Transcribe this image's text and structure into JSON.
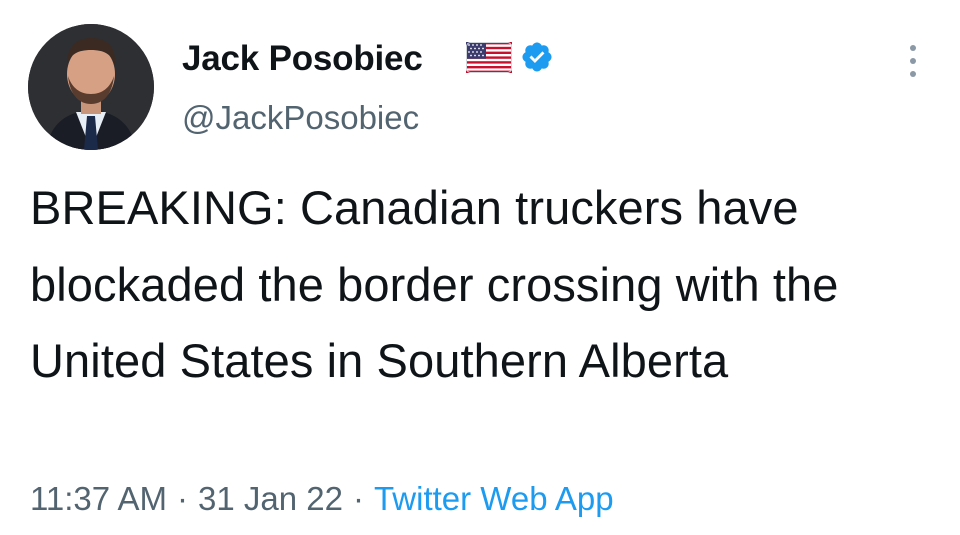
{
  "author": {
    "display_name": "Jack Posobiec",
    "handle": "@JackPosobiec",
    "flag_icon": "us-flag-icon",
    "verified_icon": "verified-badge-icon",
    "verified_color": "#1d9bf0"
  },
  "tweet": {
    "text": "BREAKING: Canadian truckers have blockaded the border crossing with the United States in Southern Alberta",
    "time": "11:37 AM",
    "separator": "·",
    "date": "31 Jan 22",
    "source": "Twitter Web App"
  },
  "colors": {
    "text": "#0f1419",
    "secondary": "#536471",
    "link": "#1d9bf0"
  }
}
